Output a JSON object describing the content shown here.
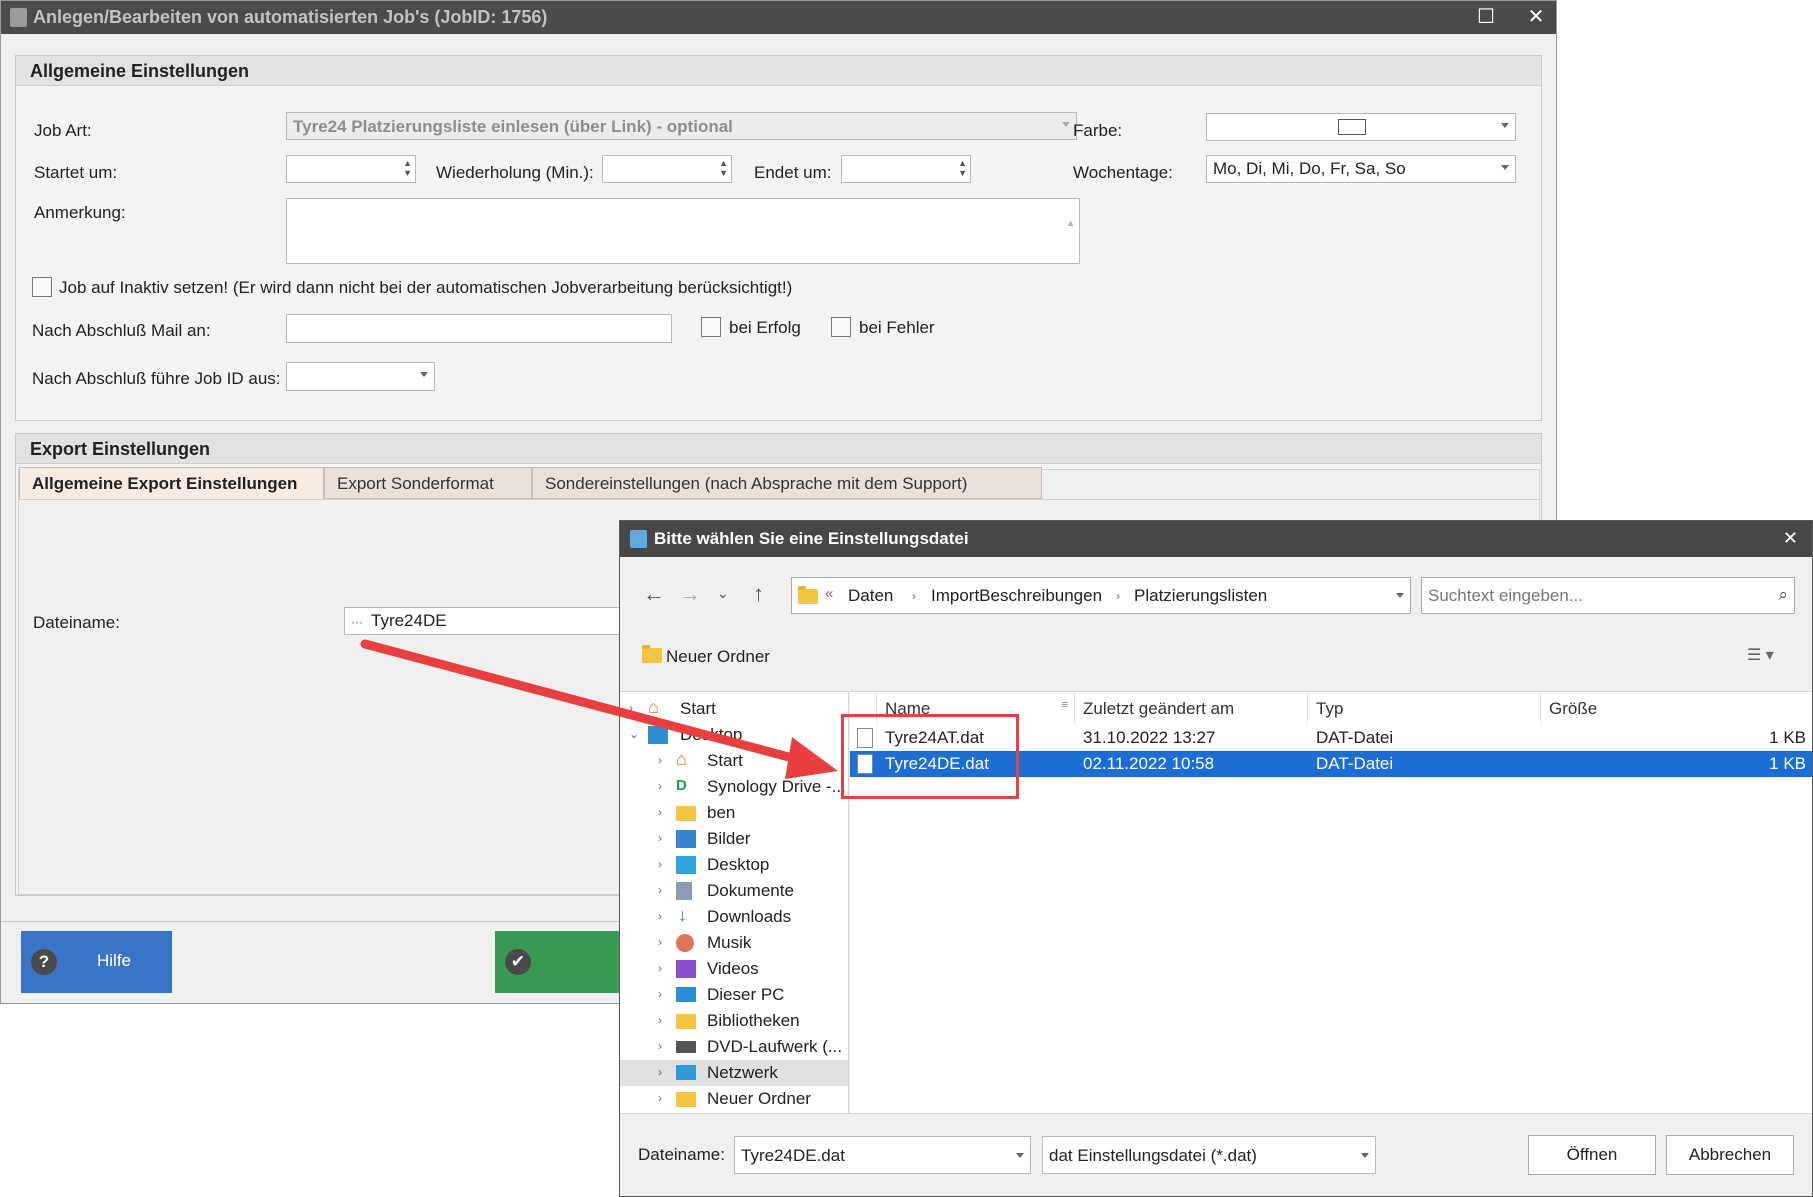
{
  "main": {
    "title": "Anlegen/Bearbeiten von automatisierten Job's (JobID: 1756)",
    "window_controls": {
      "maximize": "☐",
      "close": "✕"
    },
    "general": {
      "header": "Allgemeine Einstellungen",
      "job_art_label": "Job Art:",
      "job_art_value": "Tyre24 Platzierungsliste einlesen (über Link) - optional",
      "farbe_label": "Farbe:",
      "startet_label": "Startet um:",
      "wiederholung_label": "Wiederholung (Min.):",
      "endet_label": "Endet um:",
      "wochentage_label": "Wochentage:",
      "wochentage_value": "Mo, Di, Mi, Do, Fr, Sa, So",
      "anmerkung_label": "Anmerkung:",
      "inaktiv_label": "Job auf Inaktiv setzen! (Er wird dann nicht bei der automatischen Jobverarbeitung berücksichtigt!)",
      "mail_label": "Nach Abschluß Mail an:",
      "bei_erfolg_label": "bei Erfolg",
      "bei_fehler_label": "bei Fehler",
      "job_id_label": "Nach Abschluß führe Job ID aus:"
    },
    "export": {
      "header": "Export Einstellungen",
      "tabs": [
        {
          "label": "Allgemeine Export Einstellungen"
        },
        {
          "label": "Export Sonderformat"
        },
        {
          "label": "Sondereinstellungen (nach Absprache mit dem Support)"
        }
      ],
      "dateiname_label": "Dateiname:",
      "dateiname_button": "···",
      "dateiname_value": "Tyre24DE"
    },
    "buttons": {
      "hilfe_label": "Hilfe",
      "hilfe_icon": "?",
      "ok_icon": "✔"
    }
  },
  "dialog": {
    "title": "Bitte wählen Sie eine Einstellungsdatei",
    "close": "✕",
    "nav": {
      "back": "←",
      "forward": "→",
      "recent": "⌄",
      "up": "↑"
    },
    "address": {
      "overflow": "«",
      "crumbs": [
        "Daten",
        "ImportBeschreibungen",
        "Platzierungslisten"
      ]
    },
    "search_placeholder": "Suchtext eingeben...",
    "new_folder_label": "Neuer Ordner",
    "tree": [
      {
        "label": "Start",
        "icon": "home-icon"
      },
      {
        "label": "Desktop",
        "icon": "desktop-icon"
      },
      {
        "label": "Start",
        "icon": "home-icon"
      },
      {
        "label": "Synology Drive -...",
        "icon": "synology-icon"
      },
      {
        "label": "ben",
        "icon": "folder-icon"
      },
      {
        "label": "Bilder",
        "icon": "pictures-icon"
      },
      {
        "label": "Desktop",
        "icon": "desktop-icon"
      },
      {
        "label": "Dokumente",
        "icon": "documents-icon"
      },
      {
        "label": "Downloads",
        "icon": "download-icon"
      },
      {
        "label": "Musik",
        "icon": "music-icon"
      },
      {
        "label": "Videos",
        "icon": "videos-icon"
      },
      {
        "label": "Dieser PC",
        "icon": "pc-icon"
      },
      {
        "label": "Bibliotheken",
        "icon": "folder-icon"
      },
      {
        "label": "DVD-Laufwerk (...",
        "icon": "dvd-icon"
      },
      {
        "label": "Netzwerk",
        "icon": "network-icon"
      },
      {
        "label": "Neuer Ordner",
        "icon": "folder-icon"
      }
    ],
    "columns": {
      "name": "Name",
      "modified": "Zuletzt geändert am",
      "type": "Typ",
      "size": "Größe"
    },
    "files": [
      {
        "name": "Tyre24AT.dat",
        "modified": "31.10.2022 13:27",
        "type": "DAT-Datei",
        "size": "1 KB"
      },
      {
        "name": "Tyre24DE.dat",
        "modified": "02.11.2022 10:58",
        "type": "DAT-Datei",
        "size": "1 KB"
      }
    ],
    "filename_label": "Dateiname:",
    "filename_value": "Tyre24DE.dat",
    "filter_value": "dat Einstellungsdatei (*.dat)",
    "open_label": "Öffnen",
    "cancel_label": "Abbrechen"
  },
  "colors": {
    "selection": "#1c6ed4",
    "annotation_red": "#e84040",
    "hilfe_blue": "#3a74c7",
    "ok_green": "#3a9a55"
  }
}
